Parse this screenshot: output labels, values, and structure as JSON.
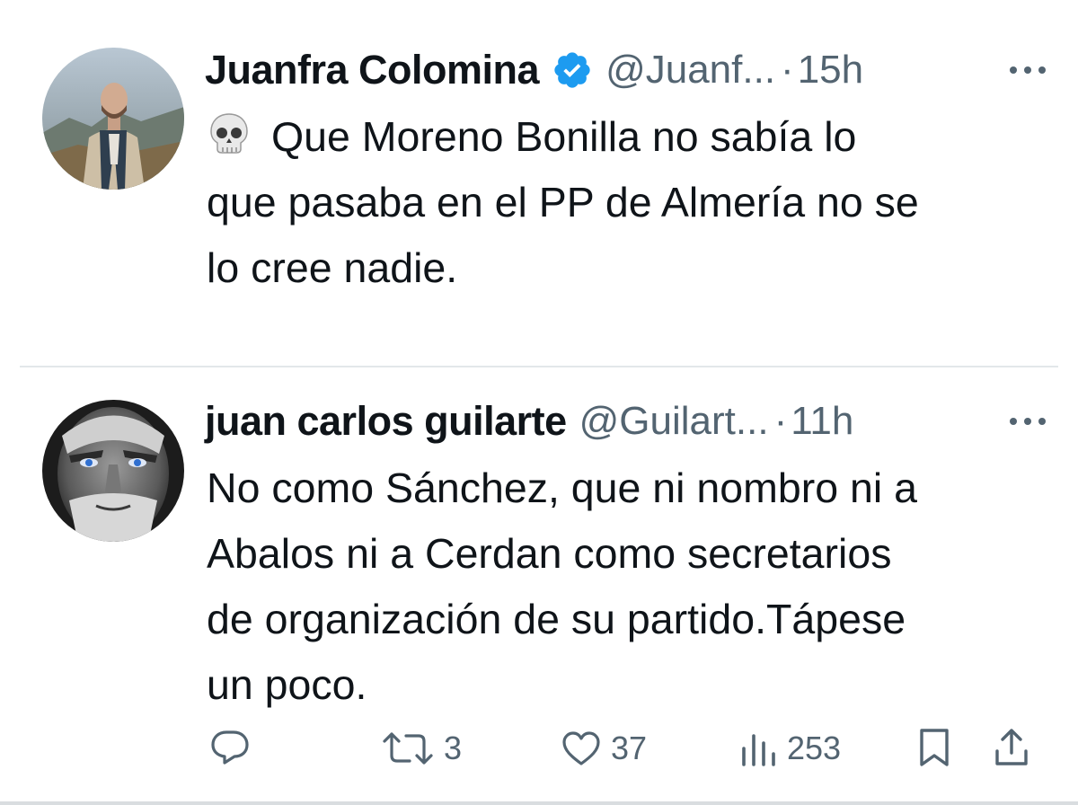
{
  "tweets": [
    {
      "display_name": "Juanfra Colomina",
      "verified": true,
      "handle": "@Juanf...",
      "separator": "·",
      "time": "15h",
      "emoji": "💀",
      "lines": [
        "Que Moreno Bonilla no sabía lo",
        "que pasaba en el PP de Almería no se",
        "lo cree nadie."
      ]
    },
    {
      "display_name": "juan carlos guilarte",
      "verified": false,
      "handle": "@Guilart...",
      "separator": "·",
      "time": "11h",
      "lines": [
        "No como Sánchez, que ni nombro ni a",
        "Abalos ni a Cerdan como secretarios",
        "de organización de su partido.Tápese",
        "un poco."
      ],
      "actions": {
        "retweets": "3",
        "likes": "37",
        "views": "253"
      }
    }
  ],
  "icons": {
    "verified": "verified-badge-icon",
    "more": "more-options-icon",
    "reply": "reply-icon",
    "retweet": "retweet-icon",
    "like": "heart-icon",
    "views": "views-icon",
    "bookmark": "bookmark-icon",
    "share": "share-icon"
  },
  "colors": {
    "text": "#0f1419",
    "secondary": "#536471",
    "verified": "#1d9bf0",
    "divider": "#e3e7ea"
  }
}
